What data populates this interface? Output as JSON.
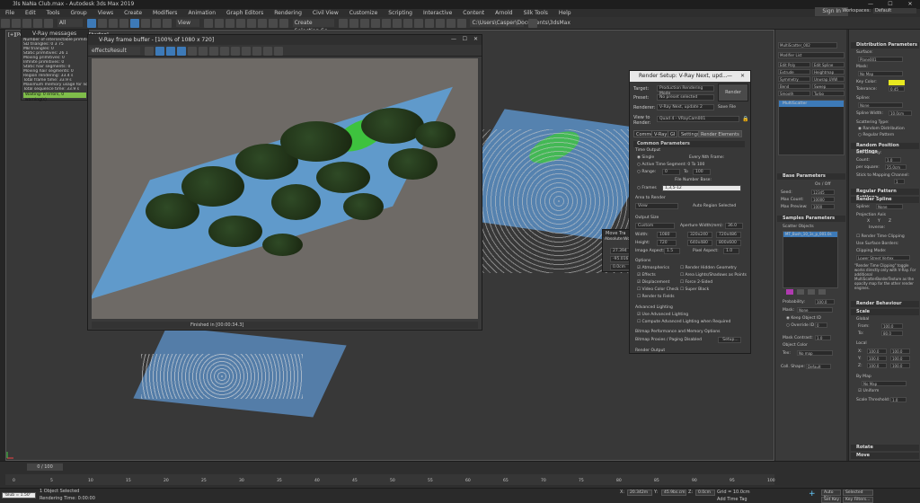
{
  "app": {
    "title": "3ls NaNa Club.max - Autodesk 3ds Max 2019"
  },
  "menu": [
    "File",
    "Edit",
    "Tools",
    "Group",
    "Views",
    "Create",
    "Modifiers",
    "Animation",
    "Graph Editors",
    "Rendering",
    "Civil View",
    "Customize",
    "Scripting",
    "Interactive",
    "Content",
    "Arnold",
    "Silk Tools",
    "Help"
  ],
  "header": {
    "sign_in": "Sign In",
    "workspaces_label": "Workspaces:",
    "workspace_value": "Default"
  },
  "toolbar": {
    "selection_filter": "All",
    "view_dropdown": "View",
    "create_selection_set": "Create Selection Se",
    "path": "C:\\Users\\Casper\\Documents\\3dsMax"
  },
  "viewport": {
    "label": "[+][Perspective][Standard][Default Shading]"
  },
  "vray_log": {
    "title": "V-Ray messages",
    "lines": [
      "Number of intersectable primitives: 317...",
      "SD triangles: 0 3 75",
      "MB triangles: 0",
      "Static primitives: 26 1",
      "Moving primitives: 0",
      "Infinite primitives: 0",
      "Static hair segments: 0",
      "Moving hair segments: 0",
      "Region rendering: 33.4 s",
      "Total frame time: 33.9 s",
      "Maximum memory usage for license: 0",
      "Total sequence time: 33.9 s"
    ],
    "progress": "Waiting: 0 errors, 0 warning(s)"
  },
  "vfb": {
    "title": "V-Ray frame buffer - [100% of 1080 x 720]",
    "channel": "effectsResult",
    "status": "Finished in [00:00:34.3]"
  },
  "move_dialog": {
    "title": "Move Tra",
    "label": "Absolute:Wor",
    "x": "27.394",
    "y": "-95.016",
    "z": "0.0cm"
  },
  "render_setup": {
    "title": "Render Setup: V-Ray Next, upd...",
    "target_label": "Target:",
    "target_value": "Production Rendering Mode",
    "preset_label": "Preset:",
    "preset_value": "No preset selected",
    "renderer_label": "Renderer:",
    "renderer_value": "V-Ray Next, update 2",
    "save_file": "Save File",
    "view_label": "View to Render:",
    "view_value": "Quad 4 - VRayCam001",
    "render_button": "Render",
    "tabs": [
      "Common",
      "V-Ray",
      "GI",
      "Settings",
      "Render Elements"
    ],
    "common_params": "Common Parameters",
    "time_output": "Time Output",
    "single": "Single",
    "every_nth": "Every Nth Frame:",
    "active_segment": "Active Time Segment:",
    "active_segment_value": "0 To 100",
    "range": "Range:",
    "range_from": "0",
    "range_to_label": "To",
    "range_to": "100",
    "file_number_base": "File Number Base:",
    "frames_label": "Frames",
    "frames_value": "1,3,5-12",
    "area_label": "Area to Render",
    "area_value": "View",
    "auto_region": "Auto Region Selected",
    "output_size": "Output Size",
    "output_preset": "Custom",
    "aperture_label": "Aperture Width(mm):",
    "aperture_value": "36.0",
    "width_label": "Width:",
    "width_value": "1080",
    "height_label": "Height:",
    "height_value": "720",
    "res_buttons": [
      "320x240",
      "720x486",
      "640x480",
      "800x600"
    ],
    "image_aspect_label": "Image Aspect:",
    "image_aspect_value": "1.5",
    "pixel_aspect_label": "Pixel Aspect:",
    "pixel_aspect_value": "1.0",
    "options_label": "Options",
    "options": [
      "Atmospherics",
      "Effects",
      "Displacement",
      "Video Color Check",
      "Render to Fields"
    ],
    "options_right": [
      "Render Hidden Geometry",
      "Area Lights/Shadows as Points",
      "Force 2-Sided",
      "Super Black"
    ],
    "adv_lighting": "Advanced Lighting",
    "use_adv_lighting": "Use Advanced Lighting",
    "compute_adv": "Compute Advanced Lighting when Required",
    "bitmap_perf": "Bitmap Performance and Memory Options",
    "bitmap_proxies": "Bitmap Proxies / Paging Disabled",
    "setup_button": "Setup...",
    "render_output": "Render Output"
  },
  "command_panel": {
    "object_name": "MultiScatter_002",
    "modifier_list": "Modifier List",
    "buttons": [
      "Edit Poly",
      "Edit Spline",
      "Extrude",
      "Heightmap",
      "Symmetry",
      "Unwrap UVW",
      "Bend",
      "Sweep",
      "Smooth",
      "Turbo"
    ],
    "stack_item": "MultiScatter",
    "base_params": "Base Parameters",
    "on_off": "On / Off",
    "seed_label": "Seed:",
    "seed_value": "12345",
    "max_count_label": "Max Count:",
    "max_count_value": "10000",
    "max_preview_label": "Max Preview:",
    "max_preview_value": "1000",
    "samples_params": "Samples Parameters",
    "scatter_objects": "Scatter Objects",
    "scatter_item": "MT_Bush_10_1s_p_001.0s",
    "probability_label": "Probability:",
    "probability_value": "100.0",
    "mask_label": "Mask:",
    "mask_value": "None",
    "keep_id": "Keep Object ID",
    "override_id": "Override ID",
    "override_value": "0",
    "mask_contrast_label": "Mask Contrast:",
    "mask_contrast_value": "1.0",
    "object_color": "Object Color",
    "tex_label": "Tex:",
    "tex_value": "No map",
    "coll_shape_label": "Coll. Shape:",
    "coll_shape_value": "Default"
  },
  "right_panel": {
    "distribution": "Distribution Parameters",
    "surface_label": "Surface:",
    "surface_value": "Plane001",
    "mask_label": "Mask:",
    "mask_value": "No Map",
    "key_color_label": "Key Color:",
    "key_color": "#e8e820",
    "tolerance_label": "Tolerance:",
    "tolerance_value": "0.45",
    "spline_label": "Spline:",
    "spline_value": "None",
    "spline_width_label": "Spline Width:",
    "spline_width_value": "10.0cm",
    "scattering_type": "Scattering Type:",
    "random_dist": "Random Distribution",
    "regular_pattern": "Regular Pattern",
    "random_position": "Random Position Settings",
    "use_density": "Use Density:",
    "count_label": "Count:",
    "count_value": "1.0",
    "per_square_label": "per square:",
    "per_square_value": "25.0cm",
    "stick_mapping": "Stick to Mapping Channel:",
    "stick_value": "1",
    "regular_settings": "Regular Pattern Settings",
    "render_spline": "Render Spline",
    "rs_spline_label": "Spline:",
    "rs_spline_value": "None",
    "projection_axis": "Projection Axis",
    "axis": [
      "X",
      "Y",
      "Z"
    ],
    "inverse": "Inverse:",
    "render_time_clipping": "Render Time Clipping",
    "use_surface_borders": "Use Surface Borders:",
    "clipping_mode": "Clipping Mode:",
    "clipping_value": "Lower Street Vertex",
    "note": "\"Render Time Clipping\" toggle works directly only with V-Ray. For additional MultiScatterBorderTexture as the opacity map for the other render engines.",
    "render_behaviour": "Render Behaviour",
    "scale": "Scale",
    "global": "Global",
    "from_label": "From:",
    "from_value": "100.0",
    "to_label": "To:",
    "to_value": "80.0",
    "local": "Local",
    "local_rows": [
      [
        "X:",
        "100.0",
        "100.0"
      ],
      [
        "Y:",
        "100.0",
        "100.0"
      ],
      [
        "Z:",
        "100.0",
        "100.0"
      ]
    ],
    "by_map": "By Map",
    "by_map_value": "No Map",
    "uniform": "Uniform",
    "scale_threshold_label": "Scale Threshold:",
    "scale_threshold_value": "1.0",
    "rotate": "Rotate",
    "move": "Move"
  },
  "timeline": {
    "frame_counter": "0 / 100",
    "ticks": [
      "0",
      "5",
      "10",
      "15",
      "20",
      "25",
      "30",
      "35",
      "40",
      "45",
      "50",
      "55",
      "60",
      "65",
      "70",
      "75",
      "80",
      "85",
      "90",
      "95",
      "100"
    ]
  },
  "status": {
    "script_input": "'blub = 1.50'",
    "objects_selected": "1 Object Selected",
    "rendering_time": "Rendering Time: 0:00:00",
    "x_label": "X:",
    "x_value": "20.342m",
    "y_label": "Y:",
    "y_value": "45.9bs.cm",
    "z_label": "Z:",
    "z_value": "0.0cm",
    "grid": "Grid = 10.0cm",
    "add_time_tag": "Add Time Tag",
    "auto_key": "Auto Key",
    "selected": "Selected",
    "set_key": "Set Key",
    "key_filters": "Key Filters..."
  }
}
